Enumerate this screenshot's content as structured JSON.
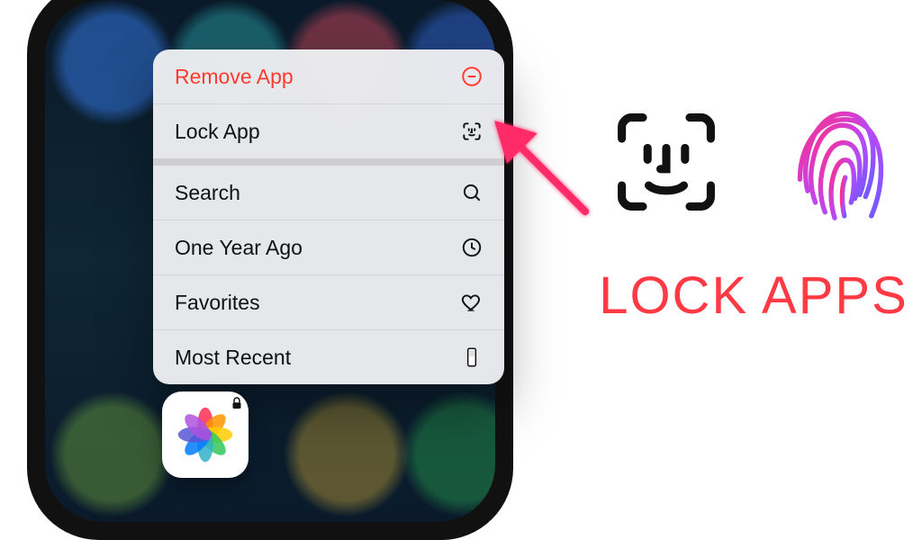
{
  "menu": {
    "items": [
      {
        "label": "Remove App",
        "icon": "remove-circle-icon",
        "destructive": true
      },
      {
        "label": "Lock App",
        "icon": "face-id-small-icon"
      },
      {
        "label": "Search",
        "icon": "search-icon"
      },
      {
        "label": "One Year Ago",
        "icon": "clock-icon"
      },
      {
        "label": "Favorites",
        "icon": "heart-icon"
      },
      {
        "label": "Most Recent",
        "icon": "phone-thumbnail-icon"
      }
    ]
  },
  "app": {
    "name": "Photos",
    "locked": true
  },
  "right": {
    "caption": "LOCK APPS"
  },
  "colors": {
    "destructive": "#ff3b30",
    "caption": "#ff3a44"
  }
}
